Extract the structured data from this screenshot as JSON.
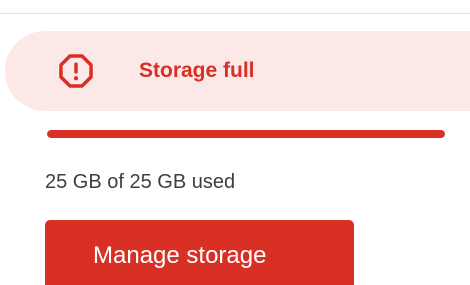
{
  "alert": {
    "title": "Storage full",
    "icon": "warning-octagon-icon",
    "color": "#d93025",
    "background": "#fce8e6"
  },
  "storage": {
    "usage_text": "25 GB of 25 GB used",
    "used_fraction": 1.0,
    "bar_color": "#d93025"
  },
  "actions": {
    "manage_label": "Manage storage"
  }
}
